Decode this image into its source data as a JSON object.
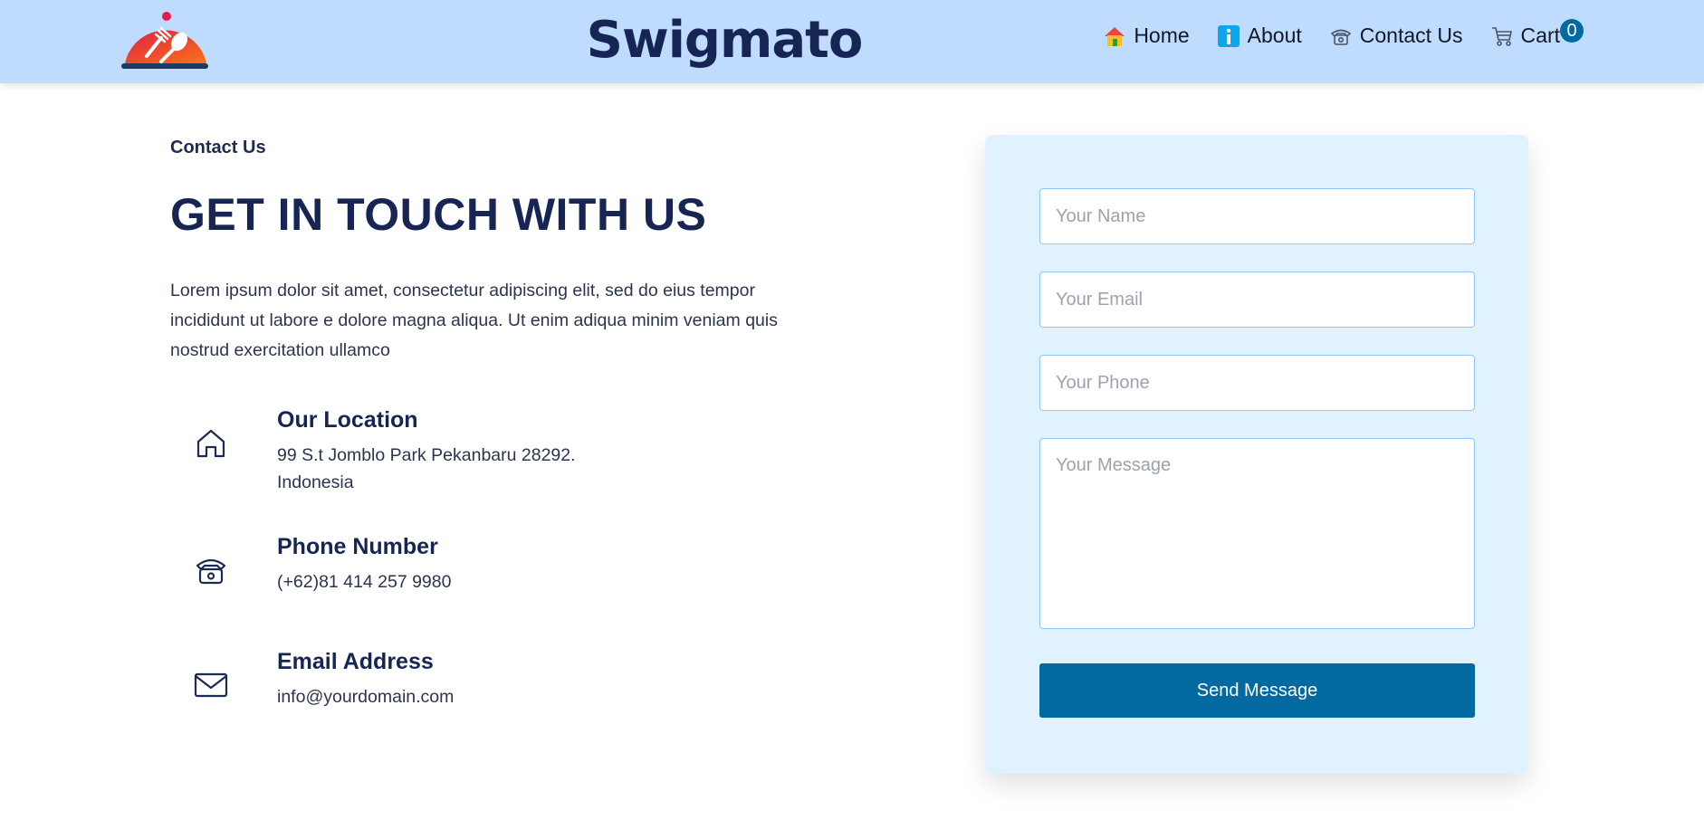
{
  "brand": {
    "name": "Swigmato",
    "logo_icon": "food-cloche-icon"
  },
  "nav": {
    "home": "Home",
    "about": "About",
    "contact": "Contact Us",
    "cart": "Cart",
    "cart_count": "0"
  },
  "section": {
    "crumb": "Contact Us",
    "heading": "GET IN TOUCH WITH US",
    "intro": "Lorem ipsum dolor sit amet, consectetur adipiscing elit, sed do eius tempor incididunt ut labore e dolore magna aliqua. Ut enim adiqua minim veniam quis nostrud exercitation ullamco"
  },
  "info": {
    "location": {
      "title": "Our Location",
      "line1": "99 S.t Jomblo Park Pekanbaru 28292.",
      "line2": "Indonesia"
    },
    "phone": {
      "title": "Phone Number",
      "value": "(+62)81 414 257 9980"
    },
    "email": {
      "title": "Email Address",
      "value": "info@yourdomain.com"
    }
  },
  "form": {
    "name_placeholder": "Your Name",
    "email_placeholder": "Your Email",
    "phone_placeholder": "Your Phone",
    "message_placeholder": "Your Message",
    "submit_label": "Send Message"
  },
  "colors": {
    "navbar": "#bfdbfe",
    "heading": "#172554",
    "card": "#e0f2fe",
    "button": "#0369a1"
  }
}
